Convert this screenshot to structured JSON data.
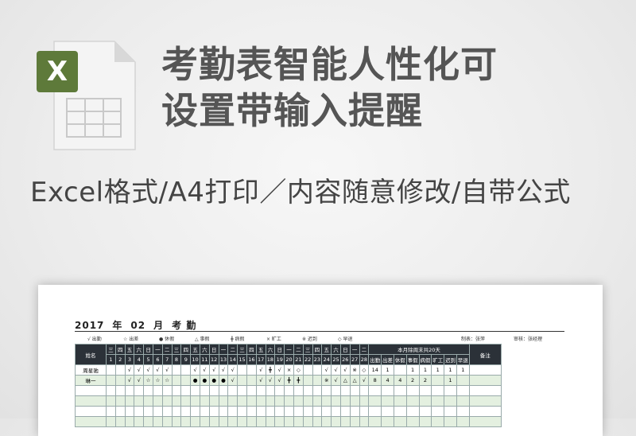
{
  "heading": {
    "line1": "考勤表智能人性化可",
    "line2": "设置带输入提醒"
  },
  "tagline": "Excel格式/A4打印／内容随意修改/自带公式",
  "icon": {
    "name": "excel-file-icon",
    "letter": "X",
    "color": "#5e7a3a"
  },
  "sheet": {
    "title": {
      "year": "2017",
      "year_unit": "年",
      "month": "02",
      "month_unit": "月",
      "label": "考 勤"
    },
    "maker_label": "制表：张萍",
    "reviewer_label": "审核：张经理",
    "legend": [
      {
        "symbol": "√",
        "text": "出勤"
      },
      {
        "symbol": "☆",
        "text": "出差"
      },
      {
        "symbol": "●",
        "text": "休假"
      },
      {
        "symbol": "△",
        "text": "事假"
      },
      {
        "symbol": "╋",
        "text": "病假"
      },
      {
        "symbol": "×",
        "text": "旷工"
      },
      {
        "symbol": "※",
        "text": "迟到"
      },
      {
        "symbol": "◇",
        "text": "早退"
      }
    ],
    "name_header": "姓名",
    "weekdays": [
      "三",
      "四",
      "五",
      "六",
      "日",
      "一",
      "二",
      "三",
      "四",
      "五",
      "六",
      "日",
      "一",
      "二",
      "三",
      "四",
      "五",
      "六",
      "日",
      "一",
      "二",
      "三",
      "四",
      "五",
      "六",
      "日",
      "一",
      "二"
    ],
    "days": [
      "1",
      "2",
      "3",
      "4",
      "5",
      "6",
      "7",
      "8",
      "9",
      "10",
      "11",
      "12",
      "13",
      "14",
      "15",
      "16",
      "17",
      "18",
      "19",
      "20",
      "21",
      "22",
      "23",
      "24",
      "25",
      "26",
      "27",
      "28"
    ],
    "summary_header": "本月除周末共20天",
    "summary_cols": [
      "出勤",
      "出差",
      "休假",
      "事假",
      "病假",
      "旷工",
      "迟到",
      "早退"
    ],
    "note_header": "备注",
    "rows": [
      {
        "name": "周星驰",
        "marks": [
          "",
          "",
          "√",
          "√",
          "√",
          "√",
          "√",
          "",
          "",
          "√",
          "√",
          "√",
          "√",
          "√",
          "",
          "",
          "√",
          "╋",
          "√",
          "×",
          "◇",
          "",
          "",
          "√",
          "√",
          "√",
          "※",
          "◇"
        ],
        "summary": [
          "14",
          "1",
          "",
          "1",
          "1",
          "1",
          "1",
          "1"
        ],
        "note": ""
      },
      {
        "name": "琳一",
        "marks": [
          "",
          "",
          "√",
          "√",
          "☆",
          "☆",
          "☆",
          "",
          "",
          "●",
          "●",
          "●",
          "●",
          "√",
          "",
          "",
          "√",
          "√",
          "√",
          "╋",
          "╋",
          "",
          "",
          "※",
          "√",
          "△",
          "△",
          "√"
        ],
        "summary": [
          "8",
          "4",
          "4",
          "2",
          "2",
          "",
          "1",
          ""
        ],
        "note": ""
      }
    ]
  }
}
